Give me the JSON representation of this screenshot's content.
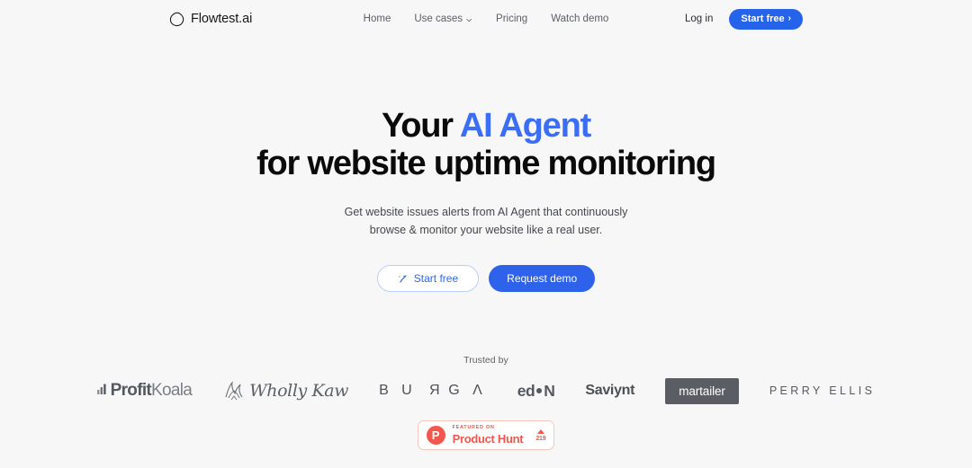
{
  "colors": {
    "background": "#f7f7f7",
    "accent_blue": "#3b6ef5",
    "primary_button": "#2f62ea",
    "nav_button": "#2563eb",
    "producthunt_red": "#f2564c",
    "logo_gray": "#55585e"
  },
  "header": {
    "brand": {
      "name": "Flowtest.ai",
      "mark": "blob-icon"
    },
    "nav": [
      {
        "label": "Home",
        "has_dropdown": false
      },
      {
        "label": "Use cases",
        "has_dropdown": true,
        "icon": "chevron-down-icon"
      },
      {
        "label": "Pricing",
        "has_dropdown": false
      },
      {
        "label": "Watch demo",
        "has_dropdown": false
      }
    ],
    "login_label": "Log in",
    "start_free": {
      "label": "Start free",
      "arrow": "›"
    }
  },
  "hero": {
    "headline_part1": "Your ",
    "headline_accent": "AI Agent",
    "headline_line2": "for website uptime monitoring",
    "subhead_line1": "Get website issues alerts from AI Agent that continuously",
    "subhead_line2": "browse & monitor your website like a real user.",
    "cta_primary": "Request demo",
    "cta_secondary": "Start free",
    "cta_secondary_icon": "magic-wand-icon"
  },
  "trusted": {
    "label": "Trusted by",
    "logos": [
      {
        "name": "ProfitKoala",
        "bold_part": "Profit",
        "light_part": "Koala",
        "icon": "bar-chart-icon"
      },
      {
        "name": "Wholly Kaw",
        "text": "Wholly Kaw",
        "icon": "kaw-crest-icon"
      },
      {
        "name": "BURGA",
        "letters": [
          "B",
          "U",
          "R",
          "G",
          "A"
        ]
      },
      {
        "name": "edON",
        "prefix": "ed",
        "suffix": "N"
      },
      {
        "name": "Saviynt",
        "text": "Saviynt"
      },
      {
        "name": "martailer",
        "text": "martailer"
      },
      {
        "name": "PERRY ELLIS",
        "text": "PERRY ELLIS"
      }
    ]
  },
  "product_hunt": {
    "featured_label": "FEATURED ON",
    "name": "Product Hunt",
    "logo_letter": "P",
    "upvotes": "219"
  }
}
